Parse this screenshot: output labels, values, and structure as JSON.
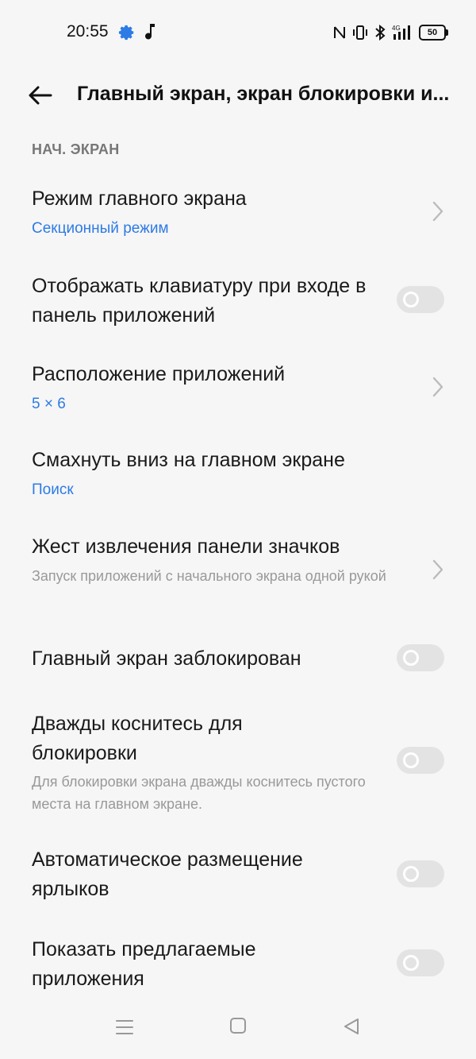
{
  "status_bar": {
    "time": "20:55",
    "battery": "50",
    "network": "4G"
  },
  "header": {
    "title": "Главный экран, экран блокировки и..."
  },
  "section": {
    "label": "НАЧ. ЭКРАН"
  },
  "items": [
    {
      "title": "Режим главного экрана",
      "value": "Секционный режим",
      "control": "chevron"
    },
    {
      "title": "Отображать клавиатуру при входе в панель приложений",
      "control": "toggle",
      "on": false
    },
    {
      "title": "Расположение приложений",
      "value": "5 × 6",
      "control": "chevron"
    },
    {
      "title": "Смахнуть вниз на главном экране",
      "value": "Поиск"
    },
    {
      "title": "Жест извлечения панели значков",
      "description": "Запуск приложений с начального экрана одной рукой",
      "control": "chevron"
    },
    {
      "title": "Главный экран заблокирован",
      "control": "toggle",
      "on": false
    },
    {
      "title": "Дважды коснитесь для блокировки",
      "description": "Для блокировки экрана дважды коснитесь пустого места на главном экране.",
      "control": "toggle",
      "on": false
    },
    {
      "title": "Автоматическое размещение ярлыков",
      "control": "toggle",
      "on": false
    },
    {
      "title": "Показать предлагаемые приложения",
      "control": "toggle",
      "on": false
    }
  ],
  "colors": {
    "accent": "#2d7be5",
    "background": "#f6f6f6",
    "toggle_off": "#e3e3e3"
  },
  "icons": {
    "status": [
      "gear-icon",
      "music-note-icon",
      "nfc-icon",
      "vibrate-icon",
      "bluetooth-icon",
      "signal-icon",
      "battery-icon"
    ],
    "nav": [
      "menu-icon",
      "home-icon",
      "back-triangle-icon"
    ]
  }
}
